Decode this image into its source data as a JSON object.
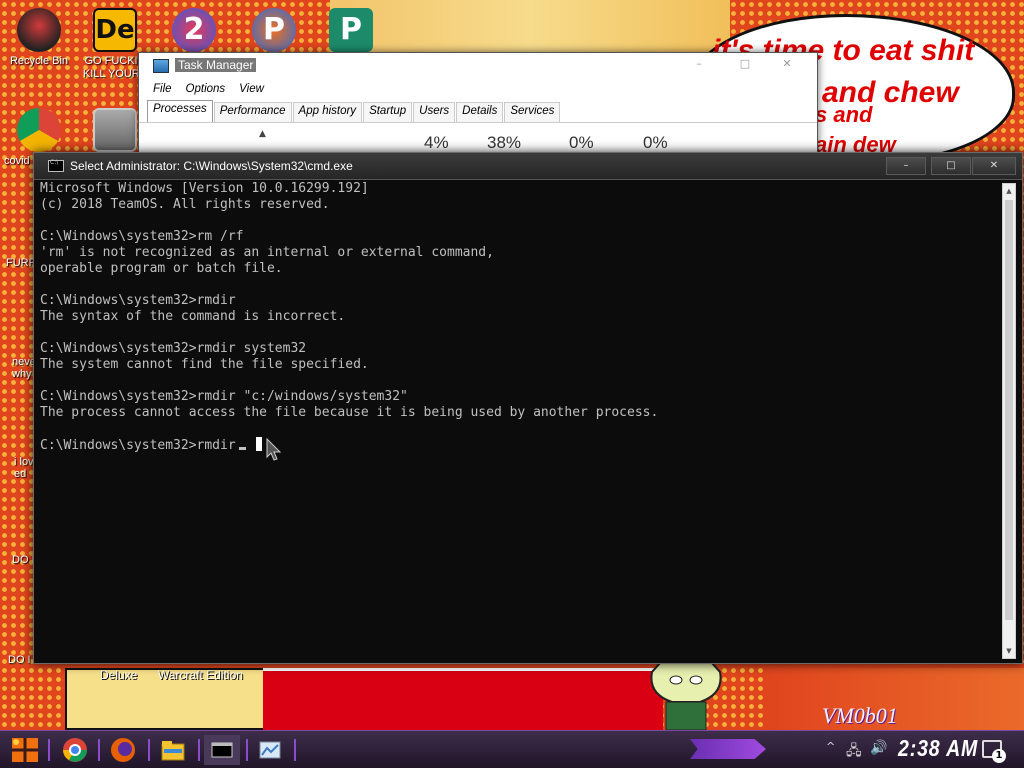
{
  "wallpaper": {
    "speech_bubble": [
      "it's time to eat shit",
      "and chew",
      "s and",
      "ain dew"
    ],
    "bottom_labels": [
      "Deluxe",
      "Warcraft Edition"
    ],
    "signature": "VM0b01"
  },
  "desktop_icons": [
    {
      "label": "Recycle Bin",
      "icon": "recycle-bin-icon"
    },
    {
      "label": "GO FUCKIN KILL YOURS",
      "icon": "de-app-icon"
    },
    {
      "label": "",
      "icon": "number-2-icon"
    },
    {
      "label": "",
      "icon": "p-app-icon"
    },
    {
      "label": "",
      "icon": "publisher-icon"
    },
    {
      "label": "covid booste",
      "icon": "chrome-icon"
    },
    {
      "label": "",
      "icon": "window-stack-icon"
    }
  ],
  "side_fragments": [
    "FURR",
    "neve why",
    "i lov ed",
    "DO I",
    "DO I"
  ],
  "task_manager": {
    "title": "Task Manager",
    "menu": [
      "File",
      "Options",
      "View"
    ],
    "tabs": [
      "Processes",
      "Performance",
      "App history",
      "Startup",
      "Users",
      "Details",
      "Services"
    ],
    "active_tab": "Processes",
    "stats": [
      "4%",
      "38%",
      "0%",
      "0%"
    ]
  },
  "cmd": {
    "title": "Select Administrator: C:\\Windows\\System32\\cmd.exe",
    "lines": [
      "Microsoft Windows [Version 10.0.16299.192]",
      "(c) 2018 TeamOS. All rights reserved.",
      "",
      "C:\\Windows\\system32>rm /rf",
      "'rm' is not recognized as an internal or external command,",
      "operable program or batch file.",
      "",
      "C:\\Windows\\system32>rmdir",
      "The syntax of the command is incorrect.",
      "",
      "C:\\Windows\\system32>rmdir system32",
      "The system cannot find the file specified.",
      "",
      "C:\\Windows\\system32>rmdir \"c:/windows/system32\"",
      "The process cannot access the file because it is being used by another process.",
      ""
    ],
    "prompt": "C:\\Windows\\system32>rmdir",
    "window_controls": {
      "minimize": "–",
      "maximize": "□",
      "close": "✕"
    }
  },
  "taskbar": {
    "apps": [
      "start-icon",
      "chrome-icon",
      "firefox-icon",
      "file-explorer-icon",
      "cmd-icon",
      "task-manager-icon"
    ],
    "clock": "2:38 AM",
    "notification_count": "1"
  },
  "colors": {
    "cmd_bg": "#0c0c0c",
    "cmd_text": "#c0c0c0",
    "taskbar_accent": "#8a4cc8",
    "wallpaper": "#e0451e"
  }
}
